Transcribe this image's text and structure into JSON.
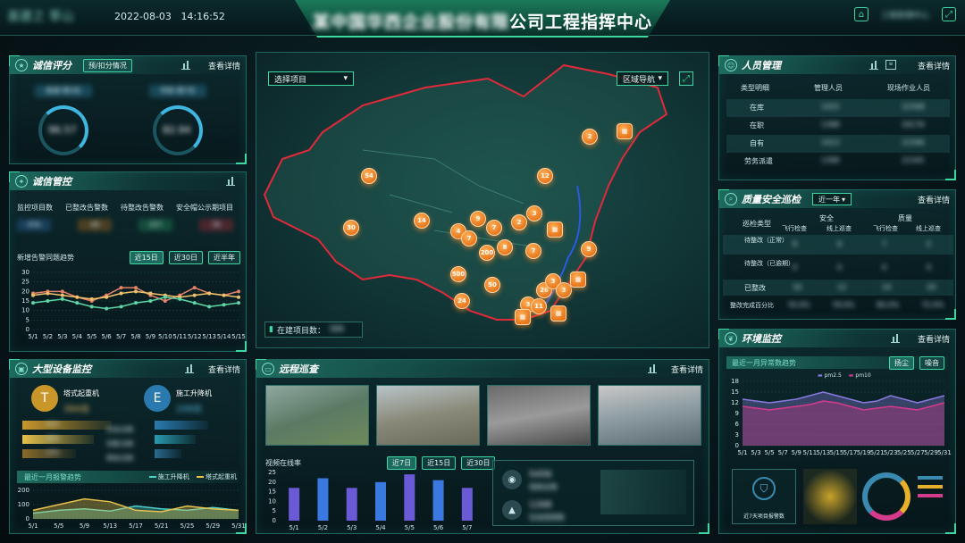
{
  "header": {
    "logo_text": "喜建之 莘山",
    "date": "2022-08-03",
    "time": "14:16:52",
    "title_prefix": "某中国华西企业股份有限",
    "title_suffix": "公司工程指挥中心",
    "right_text": "工程管理中心"
  },
  "credit": {
    "title": "诚信评分",
    "chip": "预/扣分情况",
    "more": "查看详情",
    "gauges": [
      {
        "label": "高速·第3名",
        "value": "96.57"
      },
      {
        "label": "市政·第7名",
        "value": "82.94"
      }
    ]
  },
  "control": {
    "title": "诚信管控",
    "columns": [
      "监控项目数",
      "已整改告警数",
      "待整改告警数",
      "安全帽公示期项目"
    ],
    "values": [
      "456",
      "48",
      "207",
      "36"
    ],
    "trend_label": "新增告警同题趋势",
    "ranges": [
      "近15日",
      "近30日",
      "近半年"
    ],
    "y_ticks": [
      "30",
      "25",
      "20",
      "15",
      "10",
      "5",
      "0"
    ],
    "x_ticks": [
      "5/1",
      "5/2",
      "5/3",
      "5/4",
      "5/5",
      "5/6",
      "5/7",
      "5/8",
      "5/9",
      "5/10",
      "5/11",
      "5/12",
      "5/13",
      "5/14",
      "5/15"
    ]
  },
  "equipment": {
    "title": "大型设备监控",
    "more": "查看详情",
    "cranes": [
      {
        "label": "塔式起重机",
        "value": "394台"
      },
      {
        "label": "施工升降机",
        "value": "208台"
      }
    ],
    "bars": [
      {
        "value": "40%",
        "desc": "在线/总数"
      },
      {
        "value": "36%",
        "desc": "告警/总数"
      },
      {
        "value": "24%",
        "desc": "离线/总数"
      }
    ],
    "trend_label": "最近一月报警趋势",
    "legend": [
      "施工升降机",
      "塔式起重机"
    ],
    "y_ticks": [
      "200",
      "100",
      "0"
    ],
    "x_ticks": [
      "5/1",
      "5/5",
      "5/9",
      "5/13",
      "5/17",
      "5/21",
      "5/25",
      "5/29",
      "5/31"
    ]
  },
  "map": {
    "project_select": "选择项目",
    "region_select": "区域导航",
    "projects_label": "在建项目数：",
    "projects_value": "386",
    "markers": [
      "54",
      "2",
      "12",
      "14",
      "9",
      "30",
      "4",
      "7",
      "3",
      "2",
      "7",
      "8",
      "200",
      "7",
      "9",
      "500",
      "50",
      "24",
      "3",
      "11",
      "26",
      "3",
      "3"
    ]
  },
  "patrol": {
    "title": "远程巡查",
    "more": "查看详情",
    "rate_label": "视频在线率",
    "ranges": [
      "近7日",
      "近15日",
      "近30日"
    ],
    "y_ticks": [
      "25",
      "20",
      "15",
      "10",
      "5",
      "0"
    ],
    "x_ticks": [
      "5/1",
      "5/2",
      "5/3",
      "5/4",
      "5/5",
      "5/6",
      "5/7"
    ],
    "stats": [
      {
        "value": "5456",
        "label": "视频总数"
      },
      {
        "value": "1268",
        "label": "在线视频数"
      }
    ]
  },
  "personnel": {
    "title": "人员管理",
    "more": "查看详情",
    "columns": [
      "类型明细",
      "管理人员",
      "现场作业人员"
    ],
    "rows": [
      {
        "type": "在库",
        "mgr": "1415",
        "site": "22348"
      },
      {
        "type": "在职",
        "mgr": "1398",
        "site": "20176"
      },
      {
        "type": "自有",
        "mgr": "1413",
        "site": "22346"
      },
      {
        "type": "劳务派遣",
        "mgr": "1398",
        "site": "22345"
      }
    ]
  },
  "quality": {
    "title": "质量安全巡检",
    "select": "近一年",
    "more": "查看详情",
    "head_type": "巡检类型",
    "groups": [
      "安全",
      "质量"
    ],
    "subcols": [
      "飞行检查",
      "线上巡查",
      "飞行检查",
      "线上巡查"
    ],
    "rows": [
      {
        "label": "待整改（正常）",
        "vals": [
          "8",
          "6",
          "7",
          "5"
        ]
      },
      {
        "label": "待整改（已逾期）",
        "vals": [
          "0",
          "0",
          "0",
          "0"
        ]
      },
      {
        "label": "已整改",
        "vals": [
          "16",
          "12",
          "14",
          "10"
        ]
      },
      {
        "label": "整改完成百分比",
        "vals": [
          "76.0%",
          "78.0%",
          "80.0%",
          "75.0%"
        ]
      }
    ]
  },
  "environment": {
    "title": "环境监控",
    "more": "查看详情",
    "trend_label": "最近一月异常数趋势",
    "ranges": [
      "扬尘",
      "噪音"
    ],
    "legend": [
      "pm2.5",
      "pm10"
    ],
    "y_ticks": [
      "18",
      "15",
      "12",
      "9",
      "6",
      "3",
      "0"
    ],
    "x_ticks": [
      "5/1",
      "5/3",
      "5/5",
      "5/7",
      "5/9",
      "5/11",
      "5/13",
      "5/15",
      "5/17",
      "5/19",
      "5/21",
      "5/23",
      "5/25",
      "5/27",
      "5/29",
      "5/31"
    ],
    "bottom_label": "近7天项目报警数"
  },
  "chart_data": [
    {
      "type": "line",
      "title": "新增告警同题趋势",
      "x": [
        "5/1",
        "5/2",
        "5/3",
        "5/4",
        "5/5",
        "5/6",
        "5/7",
        "5/8",
        "5/9",
        "5/10",
        "5/11",
        "5/12",
        "5/13",
        "5/14",
        "5/15"
      ],
      "ylim": [
        0,
        30
      ],
      "series": [
        {
          "name": "",
          "color": "#e8826a",
          "values": [
            19,
            20,
            20,
            17,
            15,
            18,
            22,
            22,
            18,
            15,
            18,
            22,
            19,
            18,
            20
          ]
        },
        {
          "name": "",
          "color": "#f2c26a",
          "values": [
            18,
            19,
            18,
            17,
            16,
            17,
            19,
            20,
            19,
            18,
            17,
            18,
            19,
            18,
            17
          ]
        },
        {
          "name": "",
          "color": "#5fd6a6",
          "values": [
            14,
            15,
            16,
            14,
            12,
            11,
            12,
            14,
            15,
            17,
            16,
            14,
            12,
            13,
            14
          ]
        }
      ]
    },
    {
      "type": "area",
      "title": "最近一月报警趋势",
      "x": [
        "5/1",
        "5/5",
        "5/9",
        "5/13",
        "5/17",
        "5/21",
        "5/25",
        "5/29",
        "5/31"
      ],
      "ylim": [
        0,
        200
      ],
      "series": [
        {
          "name": "施工升降机",
          "color": "#4fd0c8",
          "values": [
            40,
            60,
            70,
            55,
            90,
            70,
            60,
            80,
            60
          ]
        },
        {
          "name": "塔式起重机",
          "color": "#e8c24a",
          "values": [
            60,
            100,
            140,
            120,
            60,
            50,
            90,
            70,
            60
          ]
        }
      ]
    },
    {
      "type": "bar",
      "title": "视频在线率",
      "categories": [
        "5/1",
        "5/2",
        "5/3",
        "5/4",
        "5/5",
        "5/6",
        "5/7"
      ],
      "values": [
        17,
        22,
        17,
        20,
        24,
        21,
        17
      ],
      "ylim": [
        0,
        25
      ]
    },
    {
      "type": "area",
      "title": "最近一月异常数趋势",
      "x": [
        "5/1",
        "5/3",
        "5/5",
        "5/7",
        "5/9",
        "5/11",
        "5/13",
        "5/15",
        "5/17",
        "5/19",
        "5/21",
        "5/23",
        "5/25",
        "5/27",
        "5/29",
        "5/31"
      ],
      "ylim": [
        0,
        18
      ],
      "series": [
        {
          "name": "pm2.5",
          "color": "#8a7ae0",
          "values": [
            13,
            12.5,
            12,
            12.5,
            13,
            14,
            15,
            14,
            13,
            12,
            12.5,
            14,
            13,
            12,
            13,
            14
          ]
        },
        {
          "name": "pm10",
          "color": "#d63a8a",
          "values": [
            11,
            10.5,
            10,
            10.5,
            11,
            11.5,
            12.5,
            12,
            11,
            10,
            10.5,
            11,
            10.5,
            10,
            11,
            12
          ]
        }
      ]
    }
  ]
}
